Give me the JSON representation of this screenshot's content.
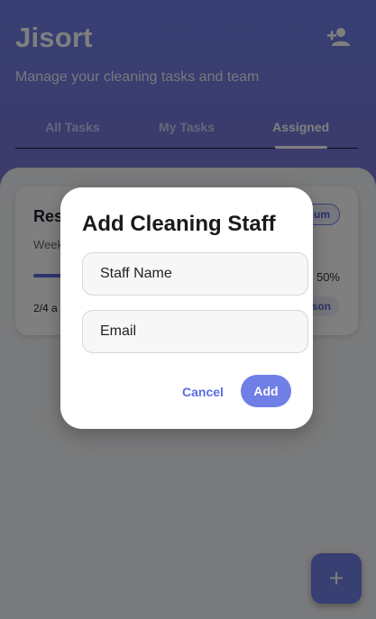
{
  "app": {
    "title": "Jisort",
    "subtitle": "Manage your cleaning tasks and team",
    "add_person_icon": "person-add-icon"
  },
  "tabs": [
    {
      "label": "All Tasks",
      "active": false
    },
    {
      "label": "My Tasks",
      "active": false
    },
    {
      "label": "Assigned",
      "active": true
    }
  ],
  "task_card": {
    "title": "Resi",
    "frequency": "Week",
    "priority": "lium",
    "progress": 0.5,
    "progress_label": "50%",
    "count": "2/4 a",
    "assignee": "lson"
  },
  "fab": {
    "icon": "plus-icon",
    "label": "+"
  },
  "dialog": {
    "title": "Add Cleaning Staff",
    "name_placeholder": "Staff Name",
    "email_placeholder": "Email",
    "cancel_label": "Cancel",
    "add_label": "Add"
  },
  "colors": {
    "accent": "#6f7fe6",
    "header_top": "#6f7fe6",
    "header_bottom": "#7a74d2",
    "overlay": "rgba(0,0,0,0.5)"
  }
}
